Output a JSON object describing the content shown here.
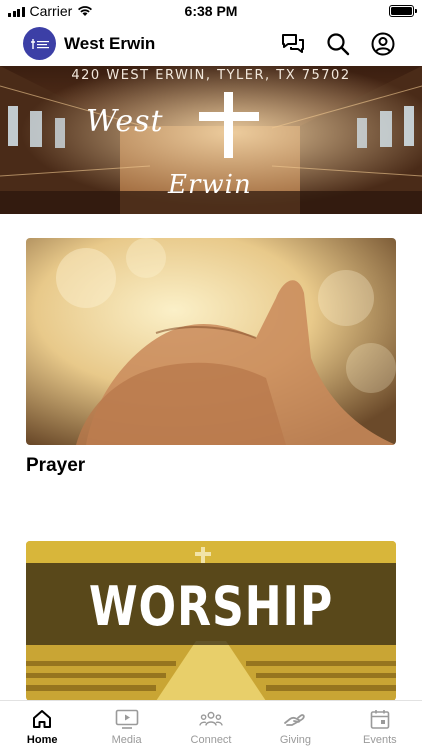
{
  "status_bar": {
    "carrier": "Carrier",
    "time": "6:38 PM"
  },
  "header": {
    "title": "West Erwin",
    "logo_icon": "church-logo",
    "actions": [
      "chat-icon",
      "search-icon",
      "profile-icon"
    ]
  },
  "banner": {
    "address": "420 WEST ERWIN, TYLER, TX 75702",
    "title_line1": "West",
    "title_line2": "Erwin"
  },
  "cards": [
    {
      "title": "Prayer"
    },
    {
      "title": "",
      "image_text": "WORSHIP"
    }
  ],
  "tab_bar": {
    "items": [
      {
        "label": "Home",
        "icon": "home-icon",
        "active": true
      },
      {
        "label": "Media",
        "icon": "media-icon",
        "active": false
      },
      {
        "label": "Connect",
        "icon": "connect-icon",
        "active": false
      },
      {
        "label": "Giving",
        "icon": "giving-icon",
        "active": false
      },
      {
        "label": "Events",
        "icon": "calendar-icon",
        "active": false
      }
    ]
  },
  "colors": {
    "logo_bg": "#3c3fa6",
    "inactive_tab": "#9a9a9a",
    "active_tab": "#000000",
    "worship_yellow": "#d8b63a"
  }
}
